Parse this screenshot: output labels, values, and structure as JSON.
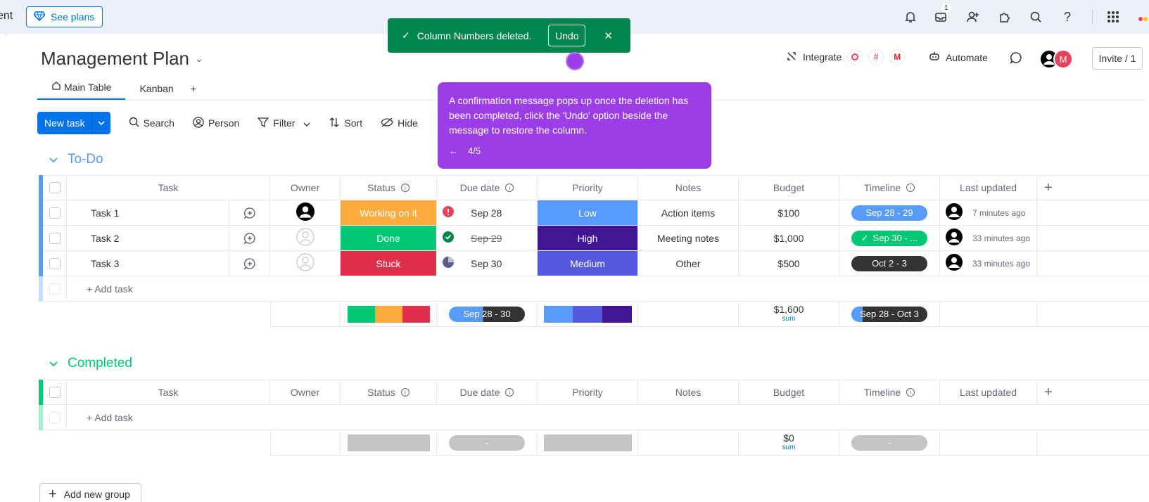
{
  "topbar": {
    "cut_text": "ent",
    "see_plans": "See plans",
    "inbox_badge": "1"
  },
  "board": {
    "title": "Management Plan",
    "tabs": [
      {
        "label": "Main Table"
      },
      {
        "label": "Kanban"
      },
      {
        "label": "+"
      }
    ],
    "integrate": "Integrate",
    "automate": "Automate",
    "avatar_letter": "M",
    "invite": "Invite / 1"
  },
  "toolbar": {
    "new_task": "New task",
    "search": "Search",
    "person": "Person",
    "filter": "Filter",
    "sort": "Sort",
    "hide": "Hide"
  },
  "columns": [
    "Task",
    "Owner",
    "Status",
    "Due date",
    "Priority",
    "Notes",
    "Budget",
    "Timeline",
    "Last updated",
    "+"
  ],
  "groups": [
    {
      "name": "To-Do",
      "color": "#579bfc",
      "rows": [
        {
          "task": "Task 1",
          "status": "Working on it",
          "status_color": "#fdab3d",
          "due": "Sep 28",
          "due_struck": false,
          "priority": "Low",
          "priority_color": "#579bfc",
          "notes": "Action items",
          "budget": "$100",
          "timeline": "Sep 28 - 29",
          "timeline_color": "#579bfc",
          "updated": "7 minutes ago"
        },
        {
          "task": "Task 2",
          "status": "Done",
          "status_color": "#00c875",
          "due": "Sep 29",
          "due_struck": true,
          "priority": "High",
          "priority_color": "#401694",
          "notes": "Meeting notes",
          "budget": "$1,000",
          "timeline": "Sep 30 - ...",
          "timeline_color": "#00c875",
          "updated": "33 minutes ago"
        },
        {
          "task": "Task 3",
          "status": "Stuck",
          "status_color": "#df2f4a",
          "due": "Sep 30",
          "due_struck": false,
          "priority": "Medium",
          "priority_color": "#5559df",
          "notes": "Other",
          "budget": "$500",
          "timeline": "Oct 2 - 3",
          "timeline_color": "#333333",
          "updated": "33 minutes ago"
        }
      ],
      "add_task": "+ Add task",
      "summary": {
        "due_range": "Sep 28 - 30",
        "budget_sum": "$1,600",
        "budget_label": "sum",
        "timeline_range": "Sep 28 - Oct 3"
      }
    },
    {
      "name": "Completed",
      "color": "#00c875",
      "rows": [],
      "add_task": "+ Add task",
      "summary": {
        "due_range": "-",
        "budget_sum": "$0",
        "budget_label": "sum",
        "timeline_range": "-"
      }
    }
  ],
  "toast": {
    "message": "Column Numbers deleted.",
    "undo": "Undo"
  },
  "tooltip": {
    "message": "A confirmation message pops up once the deletion has been completed, click the 'Undo' option beside the message to restore the column.",
    "step": "4/5"
  },
  "add_group": "Add new group"
}
